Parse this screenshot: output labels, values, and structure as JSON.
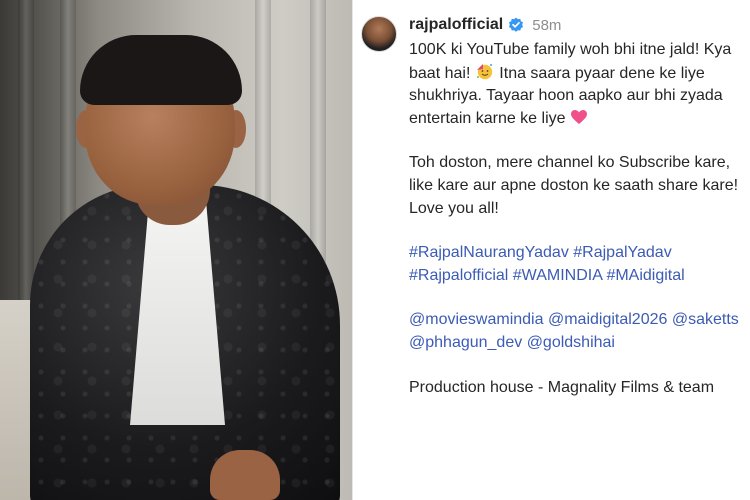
{
  "post": {
    "username": "rajpalofficial",
    "time": "58m",
    "caption": {
      "p1_a": "100K ki YouTube family woh bhi itne jald! Kya baat hai!",
      "p1_b": "Itna saara pyaar dene ke liye shukhriya. Tayaar hoon aapko aur bhi zyada entertain karne ke liye",
      "p2": "Toh doston, mere channel ko Subscribe kare, like kare aur apne doston ke saath share kare! Love you all!",
      "hashtags": [
        "#RajpalNaurangYadav",
        "#RajpalYadav",
        "#Rajpalofficial",
        "#WAMINDIA",
        "#MAidigital"
      ],
      "mentions": [
        "@movieswamindia",
        "@maidigital2026",
        "@saketts",
        "@phhagun_dev",
        "@goldshihai"
      ],
      "p5": "Production house - Magnality Films & team"
    },
    "icons": {
      "verified": "verified-badge-icon",
      "emoji1": "party-face-emoji-icon",
      "emoji2": "pink-heart-emoji-icon"
    }
  },
  "colors": {
    "link": "#3b5bb5",
    "text": "#262626",
    "muted": "#8e8e8e",
    "verified": "#3897f0"
  }
}
